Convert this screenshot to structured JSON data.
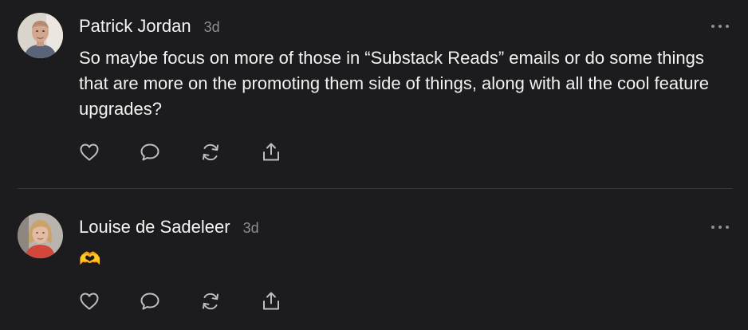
{
  "comments": [
    {
      "author": "Patrick Jordan",
      "time": "3d",
      "body": "So maybe focus on more of those in “Substack Reads” emails or do some things that are more on the promoting them side of things, along with all the cool feature upgrades?",
      "avatar_icon": "person-avatar-man"
    },
    {
      "author": "Louise de Sadeleer",
      "time": "3d",
      "body": "🫶",
      "avatar_icon": "person-avatar-woman"
    }
  ],
  "action_icons": [
    "heart-icon",
    "comment-icon",
    "restack-icon",
    "share-icon"
  ],
  "colors": {
    "background": "#1c1c1e",
    "text": "#f2f2f2",
    "muted": "#8e8e93",
    "icon": "#bdbdc2",
    "divider": "#38383b"
  }
}
